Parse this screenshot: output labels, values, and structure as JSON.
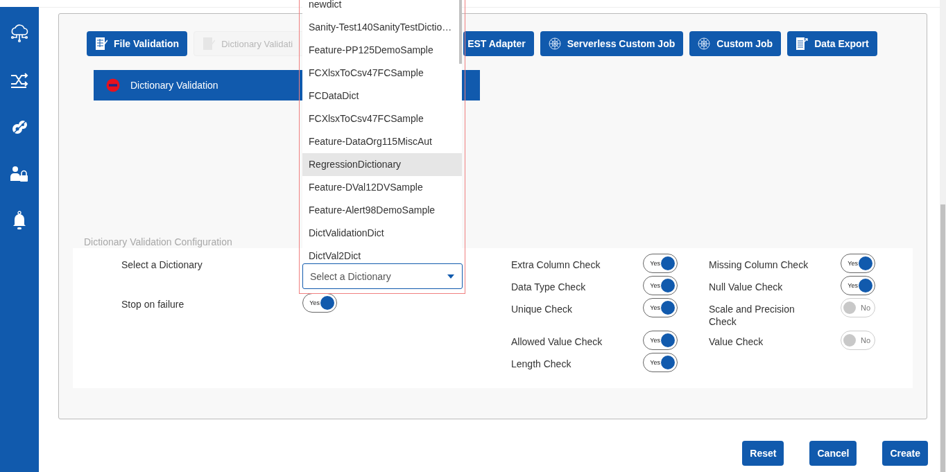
{
  "job_types": [
    {
      "label": "File Validation",
      "kind": "file",
      "disabled": false
    },
    {
      "label": "Dictionary Validati",
      "kind": "dictionary",
      "disabled": true
    },
    {
      "label": "EST Adapter",
      "kind": "plain",
      "disabled": false
    },
    {
      "label": "Serverless Custom Job",
      "kind": "job",
      "disabled": false
    },
    {
      "label": "Custom Job",
      "kind": "job",
      "disabled": false
    },
    {
      "label": "Data Export",
      "kind": "export",
      "disabled": false
    }
  ],
  "selected_jobs": [
    {
      "label": "Dictionary Validation"
    }
  ],
  "config": {
    "title": "Dictionary Validation Configuration",
    "fields": [
      {
        "label": "Select a Dictionary",
        "kind": "select",
        "placeholder": "Select a Dictionary"
      },
      {
        "label": "Stop on failure",
        "kind": "toggle",
        "on": true,
        "toggle_text": "Yes"
      }
    ],
    "checks": [
      {
        "label": "Extra Column Check",
        "on": true,
        "toggle_text": "Yes"
      },
      {
        "label": "Missing Column Check",
        "on": true,
        "toggle_text": "Yes"
      },
      {
        "label": "Data Type Check",
        "on": true,
        "toggle_text": "Yes"
      },
      {
        "label": "Null Value Check",
        "on": true,
        "toggle_text": "Yes"
      },
      {
        "label": "Unique Check",
        "on": true,
        "toggle_text": "Yes"
      },
      {
        "label": "Scale and Precision Check",
        "on": false,
        "toggle_text": "No"
      },
      {
        "label": "Allowed Value Check",
        "on": true,
        "toggle_text": "Yes"
      },
      {
        "label": "Value Check",
        "on": false,
        "toggle_text": "No"
      },
      {
        "label": "Length Check",
        "on": true,
        "toggle_text": "Yes"
      }
    ]
  },
  "dropdown": {
    "options": [
      {
        "label": "newdict",
        "selected": false
      },
      {
        "label": "Sanity-Test140SanityTestDictio…",
        "selected": false
      },
      {
        "label": "Feature-PP125DemoSample",
        "selected": false
      },
      {
        "label": "FCXlsxToCsv47FCSample",
        "selected": false
      },
      {
        "label": "FCDataDict",
        "selected": false
      },
      {
        "label": "FCXlsxToCsv47FCSample",
        "selected": false
      },
      {
        "label": "Feature-DataOrg115MiscAut",
        "selected": false
      },
      {
        "label": "RegressionDictionary",
        "selected": true
      },
      {
        "label": "Feature-DVal12DVSample",
        "selected": false
      },
      {
        "label": "Feature-Alert98DemoSample",
        "selected": false
      },
      {
        "label": "DictValidationDict",
        "selected": false
      },
      {
        "label": "DictVal2Dict",
        "selected": false
      }
    ]
  },
  "buttons": [
    "Reset",
    "Cancel",
    "Create"
  ]
}
